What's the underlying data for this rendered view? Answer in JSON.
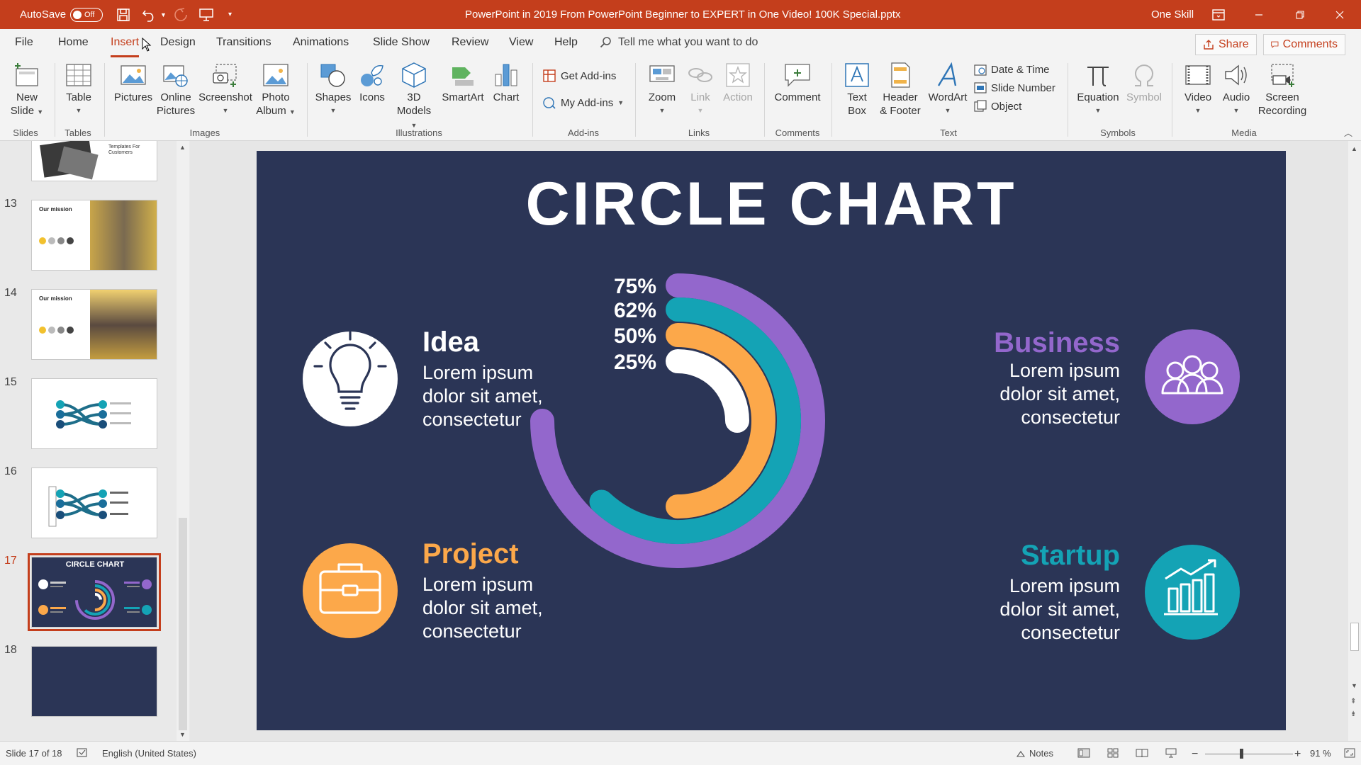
{
  "titlebar": {
    "autosave_label": "AutoSave",
    "autosave_state": "Off",
    "doc_title": "PowerPoint in 2019 From PowerPoint Beginner to EXPERT in One Video! 100K Special.pptx",
    "user": "One Skill"
  },
  "menu": {
    "tabs": [
      "File",
      "Home",
      "Insert",
      "Design",
      "Transitions",
      "Animations",
      "Slide Show",
      "Review",
      "View",
      "Help"
    ],
    "active_tab": "Insert",
    "tell_me_placeholder": "Tell me what you want to do",
    "share_label": "Share",
    "comments_label": "Comments"
  },
  "ribbon": {
    "slides": {
      "new_slide_1": "New",
      "new_slide_2": "Slide",
      "group": "Slides"
    },
    "tables": {
      "table": "Table",
      "group": "Tables"
    },
    "images": {
      "pictures": "Pictures",
      "online_1": "Online",
      "online_2": "Pictures",
      "screenshot": "Screenshot",
      "photo_1": "Photo",
      "photo_2": "Album",
      "group": "Images"
    },
    "illustrations": {
      "shapes": "Shapes",
      "icons": "Icons",
      "models_1": "3D",
      "models_2": "Models",
      "smartart": "SmartArt",
      "chart": "Chart",
      "group": "Illustrations"
    },
    "addins": {
      "get": "Get Add-ins",
      "my": "My Add-ins",
      "group": "Add-ins"
    },
    "links": {
      "zoom": "Zoom",
      "link": "Link",
      "action": "Action",
      "group": "Links"
    },
    "comments": {
      "comment": "Comment",
      "group": "Comments"
    },
    "text": {
      "textbox_1": "Text",
      "textbox_2": "Box",
      "header_1": "Header",
      "header_2": "& Footer",
      "wordart": "WordArt",
      "date_time": "Date & Time",
      "slide_number": "Slide Number",
      "object": "Object",
      "group": "Text"
    },
    "symbols": {
      "equation": "Equation",
      "symbol": "Symbol",
      "group": "Symbols"
    },
    "media": {
      "video": "Video",
      "audio": "Audio",
      "screen_1": "Screen",
      "screen_2": "Recording",
      "group": "Media"
    }
  },
  "thumbnails": {
    "numbers": [
      "13",
      "14",
      "15",
      "16",
      "17",
      "18"
    ],
    "t12_text": "Templates For Customers",
    "t13_title": "Our mission",
    "t14_title": "Our mission",
    "t17_title": "CIRCLE CHART",
    "active": "17"
  },
  "slide": {
    "title": "CIRCLE CHART",
    "idea": {
      "heading": "Idea",
      "l1": "Lorem ipsum",
      "l2": "dolor sit amet,",
      "l3": "consectetur"
    },
    "project": {
      "heading": "Project",
      "l1": "Lorem ipsum",
      "l2": "dolor sit amet,",
      "l3": "consectetur"
    },
    "business": {
      "heading": "Business",
      "l1": "Lorem ipsum",
      "l2": "dolor sit amet,",
      "l3": "consectetur"
    },
    "startup": {
      "heading": "Startup",
      "l1": "Lorem ipsum",
      "l2": "dolor sit amet,",
      "l3": "consectetur"
    },
    "colors": {
      "bg": "#2b3556",
      "purple": "#9367cc",
      "teal": "#14a3b5",
      "orange": "#fca84a",
      "white": "#ffffff"
    }
  },
  "chart_data": {
    "type": "radial-bar",
    "labels": [
      "75%",
      "62%",
      "50%",
      "25%"
    ],
    "values": [
      75,
      62,
      50,
      25
    ],
    "colors": [
      "#9367cc",
      "#14a3b5",
      "#fca84a",
      "#ffffff"
    ]
  },
  "status": {
    "slide_info": "Slide 17 of 18",
    "language": "English (United States)",
    "notes": "Notes",
    "zoom": "91 %"
  }
}
